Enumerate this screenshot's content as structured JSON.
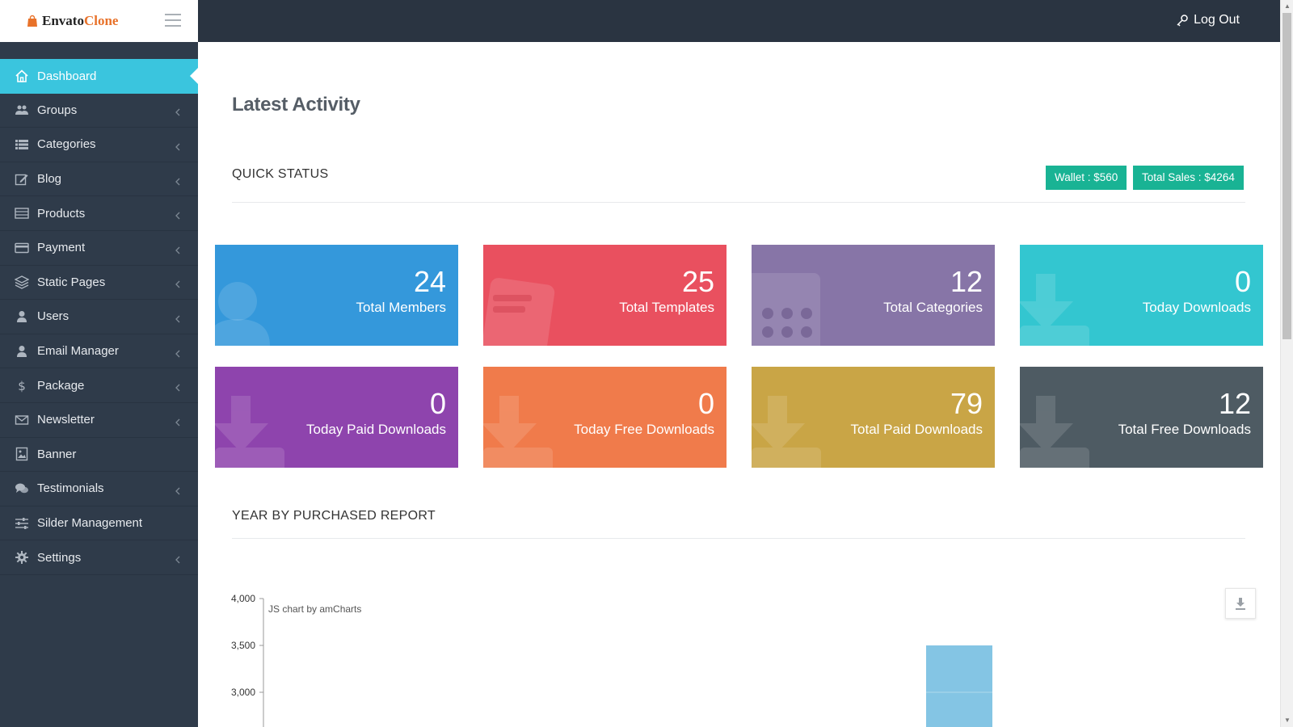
{
  "brand": {
    "name_part1": "Envato",
    "name_part2": "Clone"
  },
  "topbar": {
    "logout_label": "Log Out"
  },
  "sidebar": {
    "items": [
      {
        "label": "Dashboard",
        "icon": "home-icon",
        "active": true,
        "has_submenu": false
      },
      {
        "label": "Groups",
        "icon": "users-group-icon",
        "has_submenu": true
      },
      {
        "label": "Categories",
        "icon": "list-icon",
        "has_submenu": true
      },
      {
        "label": "Blog",
        "icon": "edit-icon",
        "has_submenu": true
      },
      {
        "label": "Products",
        "icon": "table-icon",
        "has_submenu": true
      },
      {
        "label": "Payment",
        "icon": "credit-card-icon",
        "has_submenu": true
      },
      {
        "label": "Static Pages",
        "icon": "layers-icon",
        "has_submenu": true
      },
      {
        "label": "Users",
        "icon": "user-icon",
        "has_submenu": true
      },
      {
        "label": "Email Manager",
        "icon": "user-icon",
        "has_submenu": true
      },
      {
        "label": "Package",
        "icon": "dollar-icon",
        "has_submenu": true
      },
      {
        "label": "Newsletter",
        "icon": "envelope-icon",
        "has_submenu": true
      },
      {
        "label": "Banner",
        "icon": "image-icon",
        "has_submenu": false
      },
      {
        "label": "Testimonials",
        "icon": "comments-icon",
        "has_submenu": true
      },
      {
        "label": "Silder Management",
        "icon": "sliders-icon",
        "has_submenu": false
      },
      {
        "label": "Settings",
        "icon": "gear-icon",
        "has_submenu": true
      }
    ]
  },
  "main": {
    "page_title": "Latest Activity",
    "quick_status": {
      "title": "QUICK STATUS",
      "wallet_label": "Wallet : $560",
      "total_sales_label": "Total Sales : $4264"
    },
    "cards": [
      {
        "value": "24",
        "label": "Total Members",
        "color": "#3498db",
        "icon": "user-silhouette-icon"
      },
      {
        "value": "25",
        "label": "Total Templates",
        "color": "#e9505f",
        "icon": "ticket-icon"
      },
      {
        "value": "12",
        "label": "Total Categories",
        "color": "#8775a7",
        "icon": "calculator-icon"
      },
      {
        "value": "0",
        "label": "Today Downloads",
        "color": "#33c6d0",
        "icon": "download-icon"
      },
      {
        "value": "0",
        "label": "Today Paid Downloads",
        "color": "#8e44ad",
        "icon": "download-icon"
      },
      {
        "value": "0",
        "label": "Today Free Downloads",
        "color": "#f07b4b",
        "icon": "download-icon"
      },
      {
        "value": "79",
        "label": "Total Paid Downloads",
        "color": "#c9a546",
        "icon": "download-icon"
      },
      {
        "value": "12",
        "label": "Total Free Downloads",
        "color": "#4e5b63",
        "icon": "download-icon"
      }
    ],
    "report": {
      "title": "YEAR BY PURCHASED REPORT"
    }
  },
  "chart_data": {
    "type": "bar",
    "credit": "JS chart by amCharts",
    "y_ticks": [
      "4,000",
      "3,500",
      "3,000"
    ],
    "ylim_visible": [
      2650,
      4000
    ],
    "values": [
      3500
    ],
    "color": "#84c5e4"
  }
}
